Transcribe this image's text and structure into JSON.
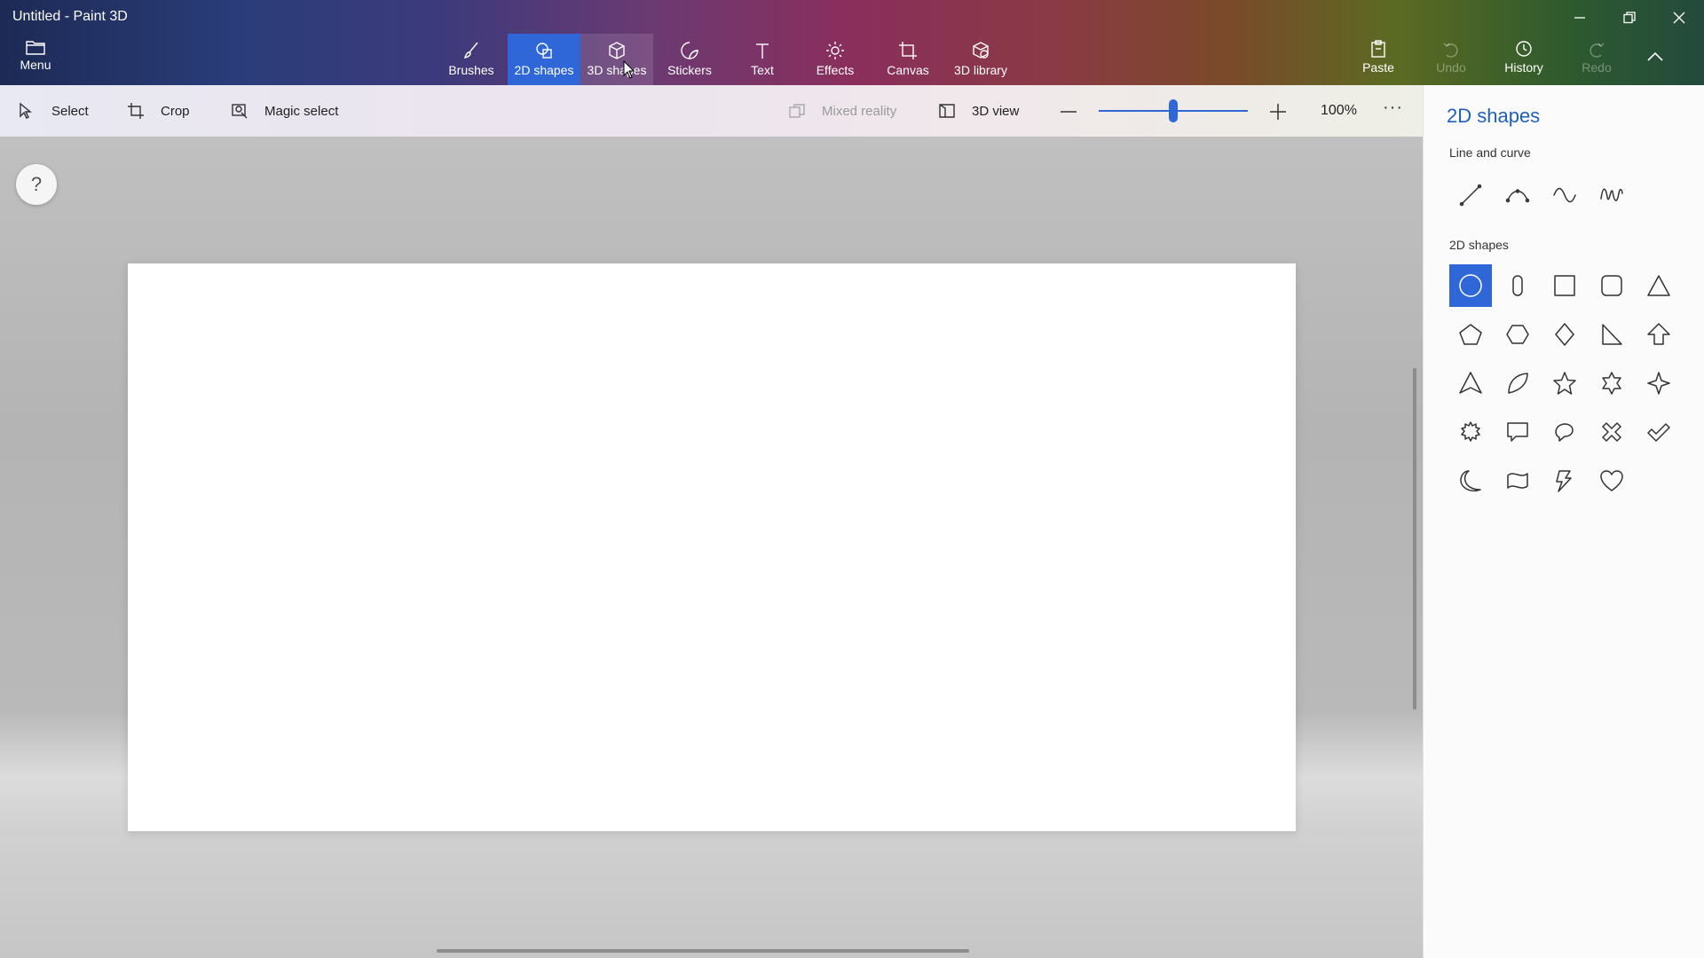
{
  "window": {
    "title": "Untitled - Paint 3D"
  },
  "ribbon": {
    "menu_label": "Menu",
    "tabs": [
      {
        "label": "Brushes",
        "icon": "brush-icon"
      },
      {
        "label": "2D shapes",
        "icon": "2d-shapes-icon",
        "state": "active"
      },
      {
        "label": "3D shapes",
        "icon": "3d-shapes-icon",
        "state": "hover"
      },
      {
        "label": "Stickers",
        "icon": "stickers-icon"
      },
      {
        "label": "Text",
        "icon": "text-icon"
      },
      {
        "label": "Effects",
        "icon": "effects-icon"
      },
      {
        "label": "Canvas",
        "icon": "canvas-icon"
      },
      {
        "label": "3D library",
        "icon": "3d-library-icon"
      }
    ],
    "actions": {
      "paste": "Paste",
      "undo": "Undo",
      "history": "History",
      "redo": "Redo"
    }
  },
  "toolbar": {
    "select": "Select",
    "crop": "Crop",
    "magic_select": "Magic select",
    "mixed_reality": "Mixed reality",
    "view_3d": "3D view",
    "zoom": "100%",
    "more": "···",
    "zoom_slider_fraction": 0.5
  },
  "help": {
    "label": "?"
  },
  "panel": {
    "title": "2D shapes",
    "line_section": "Line and curve",
    "shapes_section": "2D shapes",
    "line_tools": [
      "line-icon",
      "curve-icon",
      "three-point-curve-icon",
      "four-point-curve-icon"
    ],
    "selected_shape": "circle-icon"
  },
  "colors": {
    "accent": "#2f67d9",
    "panel_title": "#1f5fbf"
  }
}
